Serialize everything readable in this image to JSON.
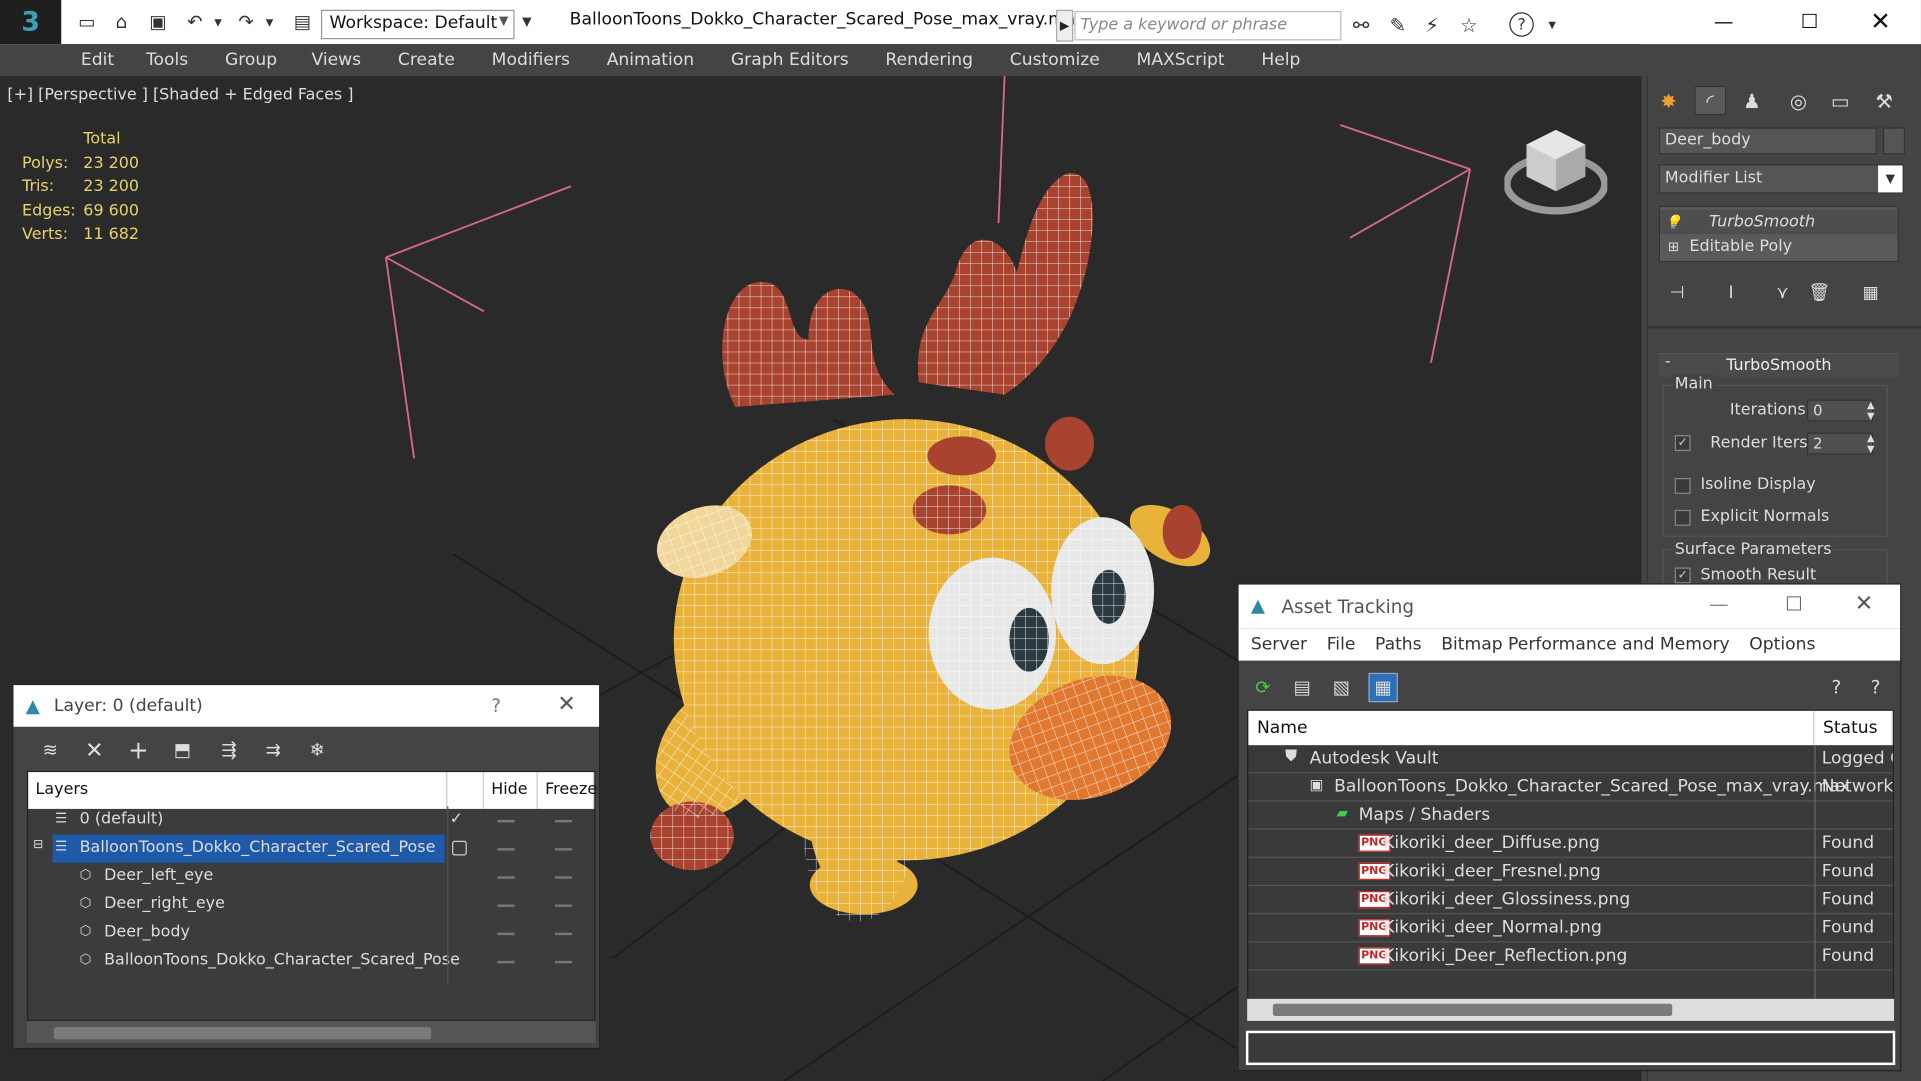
{
  "app": {
    "title": "BalloonToons_Dokko_Character_Scared_Pose_max_vray.max",
    "workspace": "Workspace: Default",
    "search_placeholder": "Type a keyword or phrase",
    "logo": "3"
  },
  "menu": [
    "Edit",
    "Tools",
    "Group",
    "Views",
    "Create",
    "Modifiers",
    "Animation",
    "Graph Editors",
    "Rendering",
    "Customize",
    "MAXScript",
    "Help"
  ],
  "viewport": {
    "label": "[+] [Perspective ] [Shaded + Edged Faces ]",
    "stats": {
      "header": "Total",
      "rows": [
        {
          "k": "Polys:",
          "v": "23 200"
        },
        {
          "k": "Tris:",
          "v": "23 200"
        },
        {
          "k": "Edges:",
          "v": "69 600"
        },
        {
          "k": "Verts:",
          "v": "11 682"
        }
      ]
    }
  },
  "command_panel": {
    "object_name": "Deer_body",
    "modifier_list": "Modifier List",
    "stack": [
      "TurboSmooth",
      "Editable Poly"
    ],
    "rollout_title": "TurboSmooth",
    "main_label": "Main",
    "iterations_label": "Iterations:",
    "iterations_value": "0",
    "render_iters_label": "Render Iters:",
    "render_iters_value": "2",
    "isoline_label": "Isoline Display",
    "explicit_normals_label": "Explicit Normals",
    "surface_params_label": "Surface Parameters",
    "smooth_result_label": "Smooth Result"
  },
  "layer_dialog": {
    "title": "Layer: 0 (default)",
    "help": "?",
    "columns": {
      "layers": "Layers",
      "hide": "Hide",
      "freeze": "Freeze"
    },
    "rows": [
      {
        "name": "0 (default)"
      },
      {
        "name": "BalloonToons_Dokko_Character_Scared_Pose"
      },
      {
        "name": "Deer_left_eye"
      },
      {
        "name": "Deer_right_eye"
      },
      {
        "name": "Deer_body"
      },
      {
        "name": "BalloonToons_Dokko_Character_Scared_Pose"
      }
    ]
  },
  "asset_dialog": {
    "title": "Asset Tracking",
    "menu": [
      "Server",
      "File",
      "Paths",
      "Bitmap Performance and Memory",
      "Options"
    ],
    "columns": {
      "name": "Name",
      "status": "Status"
    },
    "rows": [
      {
        "name": "Autodesk Vault",
        "status": "Logged Out"
      },
      {
        "name": "BalloonToons_Dokko_Character_Scared_Pose_max_vray.max",
        "status": "Network"
      },
      {
        "name": "Maps / Shaders",
        "status": ""
      },
      {
        "name": "Kikoriki_deer_Diffuse.png",
        "status": "Found"
      },
      {
        "name": "Kikoriki_deer_Fresnel.png",
        "status": "Found"
      },
      {
        "name": "Kikoriki_deer_Glossiness.png",
        "status": "Found"
      },
      {
        "name": "Kikoriki_deer_Normal.png",
        "status": "Found"
      },
      {
        "name": "Kikoriki_Deer_Reflection.png",
        "status": "Found"
      }
    ]
  },
  "colors": {
    "accent": "#1e5aa8",
    "stats_text": "#e6d26a",
    "deer_body": "#e9b23a",
    "antler": "#a8432f",
    "nose": "#e07830"
  }
}
